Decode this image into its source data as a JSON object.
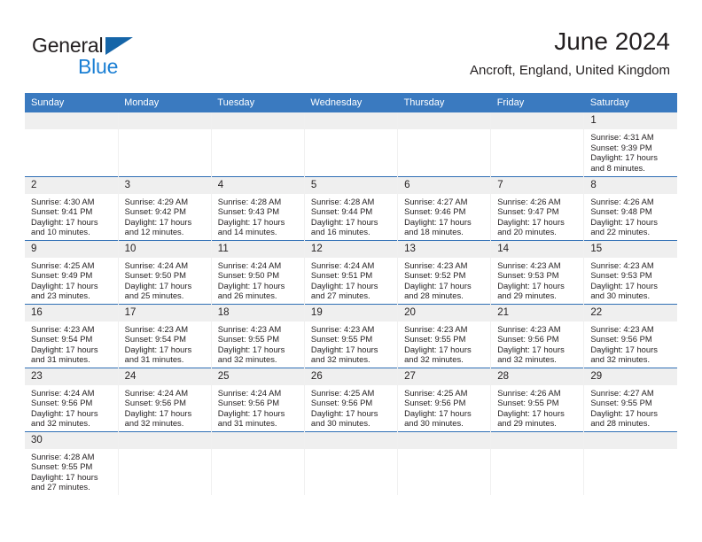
{
  "brand": {
    "name_part1": "General",
    "name_part2": "Blue",
    "triangle_color": "#1565a8",
    "blue_color": "#1b7fd4"
  },
  "header": {
    "month_title": "June 2024",
    "location": "Ancroft, England, United Kingdom",
    "header_bg": "#3a7ac0",
    "header_text_color": "#ffffff",
    "daynum_bg": "#efefef",
    "divider_color": "#2f6fb5"
  },
  "weekdays": [
    "Sunday",
    "Monday",
    "Tuesday",
    "Wednesday",
    "Thursday",
    "Friday",
    "Saturday"
  ],
  "weeks": [
    [
      {
        "day": "",
        "sunrise": "",
        "sunset": "",
        "daylight": "",
        "empty": true
      },
      {
        "day": "",
        "sunrise": "",
        "sunset": "",
        "daylight": "",
        "empty": true
      },
      {
        "day": "",
        "sunrise": "",
        "sunset": "",
        "daylight": "",
        "empty": true
      },
      {
        "day": "",
        "sunrise": "",
        "sunset": "",
        "daylight": "",
        "empty": true
      },
      {
        "day": "",
        "sunrise": "",
        "sunset": "",
        "daylight": "",
        "empty": true
      },
      {
        "day": "",
        "sunrise": "",
        "sunset": "",
        "daylight": "",
        "empty": true
      },
      {
        "day": "1",
        "sunrise": "Sunrise: 4:31 AM",
        "sunset": "Sunset: 9:39 PM",
        "daylight": "Daylight: 17 hours and 8 minutes.",
        "empty": false
      }
    ],
    [
      {
        "day": "2",
        "sunrise": "Sunrise: 4:30 AM",
        "sunset": "Sunset: 9:41 PM",
        "daylight": "Daylight: 17 hours and 10 minutes.",
        "empty": false
      },
      {
        "day": "3",
        "sunrise": "Sunrise: 4:29 AM",
        "sunset": "Sunset: 9:42 PM",
        "daylight": "Daylight: 17 hours and 12 minutes.",
        "empty": false
      },
      {
        "day": "4",
        "sunrise": "Sunrise: 4:28 AM",
        "sunset": "Sunset: 9:43 PM",
        "daylight": "Daylight: 17 hours and 14 minutes.",
        "empty": false
      },
      {
        "day": "5",
        "sunrise": "Sunrise: 4:28 AM",
        "sunset": "Sunset: 9:44 PM",
        "daylight": "Daylight: 17 hours and 16 minutes.",
        "empty": false
      },
      {
        "day": "6",
        "sunrise": "Sunrise: 4:27 AM",
        "sunset": "Sunset: 9:46 PM",
        "daylight": "Daylight: 17 hours and 18 minutes.",
        "empty": false
      },
      {
        "day": "7",
        "sunrise": "Sunrise: 4:26 AM",
        "sunset": "Sunset: 9:47 PM",
        "daylight": "Daylight: 17 hours and 20 minutes.",
        "empty": false
      },
      {
        "day": "8",
        "sunrise": "Sunrise: 4:26 AM",
        "sunset": "Sunset: 9:48 PM",
        "daylight": "Daylight: 17 hours and 22 minutes.",
        "empty": false
      }
    ],
    [
      {
        "day": "9",
        "sunrise": "Sunrise: 4:25 AM",
        "sunset": "Sunset: 9:49 PM",
        "daylight": "Daylight: 17 hours and 23 minutes.",
        "empty": false
      },
      {
        "day": "10",
        "sunrise": "Sunrise: 4:24 AM",
        "sunset": "Sunset: 9:50 PM",
        "daylight": "Daylight: 17 hours and 25 minutes.",
        "empty": false
      },
      {
        "day": "11",
        "sunrise": "Sunrise: 4:24 AM",
        "sunset": "Sunset: 9:50 PM",
        "daylight": "Daylight: 17 hours and 26 minutes.",
        "empty": false
      },
      {
        "day": "12",
        "sunrise": "Sunrise: 4:24 AM",
        "sunset": "Sunset: 9:51 PM",
        "daylight": "Daylight: 17 hours and 27 minutes.",
        "empty": false
      },
      {
        "day": "13",
        "sunrise": "Sunrise: 4:23 AM",
        "sunset": "Sunset: 9:52 PM",
        "daylight": "Daylight: 17 hours and 28 minutes.",
        "empty": false
      },
      {
        "day": "14",
        "sunrise": "Sunrise: 4:23 AM",
        "sunset": "Sunset: 9:53 PM",
        "daylight": "Daylight: 17 hours and 29 minutes.",
        "empty": false
      },
      {
        "day": "15",
        "sunrise": "Sunrise: 4:23 AM",
        "sunset": "Sunset: 9:53 PM",
        "daylight": "Daylight: 17 hours and 30 minutes.",
        "empty": false
      }
    ],
    [
      {
        "day": "16",
        "sunrise": "Sunrise: 4:23 AM",
        "sunset": "Sunset: 9:54 PM",
        "daylight": "Daylight: 17 hours and 31 minutes.",
        "empty": false
      },
      {
        "day": "17",
        "sunrise": "Sunrise: 4:23 AM",
        "sunset": "Sunset: 9:54 PM",
        "daylight": "Daylight: 17 hours and 31 minutes.",
        "empty": false
      },
      {
        "day": "18",
        "sunrise": "Sunrise: 4:23 AM",
        "sunset": "Sunset: 9:55 PM",
        "daylight": "Daylight: 17 hours and 32 minutes.",
        "empty": false
      },
      {
        "day": "19",
        "sunrise": "Sunrise: 4:23 AM",
        "sunset": "Sunset: 9:55 PM",
        "daylight": "Daylight: 17 hours and 32 minutes.",
        "empty": false
      },
      {
        "day": "20",
        "sunrise": "Sunrise: 4:23 AM",
        "sunset": "Sunset: 9:55 PM",
        "daylight": "Daylight: 17 hours and 32 minutes.",
        "empty": false
      },
      {
        "day": "21",
        "sunrise": "Sunrise: 4:23 AM",
        "sunset": "Sunset: 9:56 PM",
        "daylight": "Daylight: 17 hours and 32 minutes.",
        "empty": false
      },
      {
        "day": "22",
        "sunrise": "Sunrise: 4:23 AM",
        "sunset": "Sunset: 9:56 PM",
        "daylight": "Daylight: 17 hours and 32 minutes.",
        "empty": false
      }
    ],
    [
      {
        "day": "23",
        "sunrise": "Sunrise: 4:24 AM",
        "sunset": "Sunset: 9:56 PM",
        "daylight": "Daylight: 17 hours and 32 minutes.",
        "empty": false
      },
      {
        "day": "24",
        "sunrise": "Sunrise: 4:24 AM",
        "sunset": "Sunset: 9:56 PM",
        "daylight": "Daylight: 17 hours and 32 minutes.",
        "empty": false
      },
      {
        "day": "25",
        "sunrise": "Sunrise: 4:24 AM",
        "sunset": "Sunset: 9:56 PM",
        "daylight": "Daylight: 17 hours and 31 minutes.",
        "empty": false
      },
      {
        "day": "26",
        "sunrise": "Sunrise: 4:25 AM",
        "sunset": "Sunset: 9:56 PM",
        "daylight": "Daylight: 17 hours and 30 minutes.",
        "empty": false
      },
      {
        "day": "27",
        "sunrise": "Sunrise: 4:25 AM",
        "sunset": "Sunset: 9:56 PM",
        "daylight": "Daylight: 17 hours and 30 minutes.",
        "empty": false
      },
      {
        "day": "28",
        "sunrise": "Sunrise: 4:26 AM",
        "sunset": "Sunset: 9:55 PM",
        "daylight": "Daylight: 17 hours and 29 minutes.",
        "empty": false
      },
      {
        "day": "29",
        "sunrise": "Sunrise: 4:27 AM",
        "sunset": "Sunset: 9:55 PM",
        "daylight": "Daylight: 17 hours and 28 minutes.",
        "empty": false
      }
    ],
    [
      {
        "day": "30",
        "sunrise": "Sunrise: 4:28 AM",
        "sunset": "Sunset: 9:55 PM",
        "daylight": "Daylight: 17 hours and 27 minutes.",
        "empty": false
      },
      {
        "day": "",
        "sunrise": "",
        "sunset": "",
        "daylight": "",
        "empty": true
      },
      {
        "day": "",
        "sunrise": "",
        "sunset": "",
        "daylight": "",
        "empty": true
      },
      {
        "day": "",
        "sunrise": "",
        "sunset": "",
        "daylight": "",
        "empty": true
      },
      {
        "day": "",
        "sunrise": "",
        "sunset": "",
        "daylight": "",
        "empty": true
      },
      {
        "day": "",
        "sunrise": "",
        "sunset": "",
        "daylight": "",
        "empty": true
      },
      {
        "day": "",
        "sunrise": "",
        "sunset": "",
        "daylight": "",
        "empty": true
      }
    ]
  ]
}
